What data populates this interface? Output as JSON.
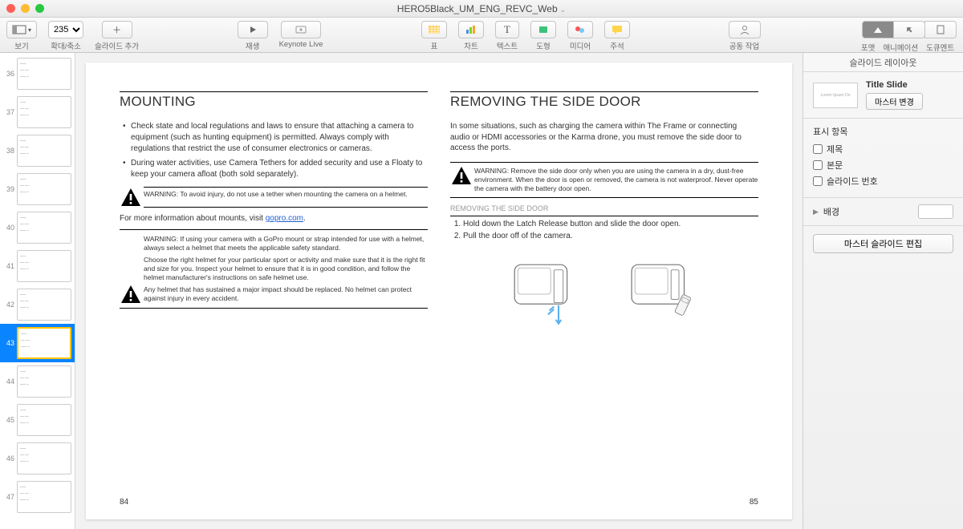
{
  "window": {
    "title": "HERO5Black_UM_ENG_REVC_Web"
  },
  "toolbar": {
    "view": "보기",
    "zoom_val": "235%",
    "zoom": "확대/축소",
    "add_slide": "슬라이드 추가",
    "play": "재생",
    "keynote_live": "Keynote Live",
    "table": "표",
    "chart": "차트",
    "text": "텍스트",
    "shape": "도형",
    "media": "미디어",
    "comment": "주석",
    "collab": "공동 작업",
    "format": "포맷",
    "animate": "애니메이션",
    "document": "도큐멘트"
  },
  "thumbs": {
    "start": 36,
    "selected": 43
  },
  "slide": {
    "left": {
      "heading": "MOUNTING",
      "b1": "Check state and local regulations and laws to ensure that attaching a camera to equipment (such as hunting equipment) is permitted. Always comply with regulations that restrict the use of consumer electronics or cameras.",
      "b2": "During water activities, use Camera Tethers for added security and use a Floaty to keep your camera afloat (both sold separately).",
      "w1": "WARNING: To avoid injury, do not use a tether when mounting the camera on a helmet.",
      "note_pre": "For more information about mounts, visit ",
      "note_link": "gopro.com",
      "w2": "WARNING: If using your camera with a GoPro mount or strap intended for use with a helmet, always select a helmet that meets the applicable safety standard.",
      "w2b": "Choose the right helmet for your particular sport or activity and make sure that it is the right fit and size for you. Inspect your helmet to ensure that it is in good condition, and follow the helmet manufacturer's instructions on safe helmet use.",
      "w2c": "Any helmet that has sustained a major impact should be replaced. No helmet can protect against injury in every accident.",
      "page": "84"
    },
    "right": {
      "heading": "REMOVING THE SIDE DOOR",
      "intro": "In some situations, such as charging the camera within The Frame or connecting audio or HDMI accessories or the Karma drone, you must remove the side door to access the ports.",
      "w1": "WARNING: Remove the side door only when you are using the camera in a dry, dust-free environment. When the door is open or removed, the camera is not waterproof. Never operate the camera with the battery door open.",
      "sub": "REMOVING THE SIDE DOOR",
      "s1": "Hold down the Latch Release button and slide the door open.",
      "s2": "Pull the door off of the camera.",
      "page": "85"
    }
  },
  "inspector": {
    "header": "슬라이드 레이아웃",
    "master_name": "Title Slide",
    "master_preview": "Lorem Ipsum Do",
    "change_master": "마스터 변경",
    "display": "표시 항목",
    "ck_title": "제목",
    "ck_body": "본문",
    "ck_num": "슬라이드 번호",
    "bg": "배경",
    "edit_master": "마스터 슬라이드 편집"
  }
}
